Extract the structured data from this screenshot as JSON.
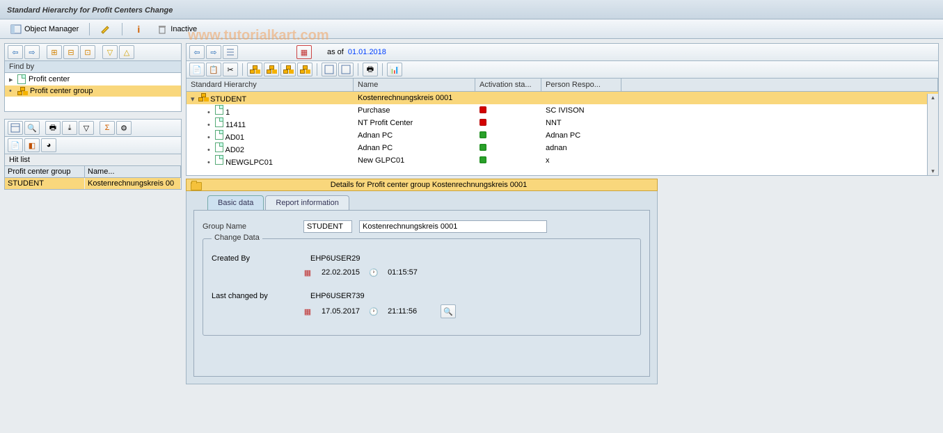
{
  "title": "Standard Hierarchy for Profit Centers Change",
  "app_toolbar": {
    "object_manager": "Object Manager",
    "inactive": "Inactive"
  },
  "watermark": "www.tutorialkart.com",
  "findby": {
    "header": "Find by",
    "items": [
      {
        "label": "Profit center",
        "selected": false
      },
      {
        "label": "Profit center group",
        "selected": true
      }
    ]
  },
  "hitlist": {
    "title": "Hit list",
    "columns": [
      "Profit center group",
      "Name..."
    ],
    "rows": [
      {
        "group": "STUDENT",
        "name": "Kostenrechnungskreis 00",
        "selected": true
      }
    ]
  },
  "asof": {
    "label": "as of",
    "date": "01.01.2018"
  },
  "grid": {
    "columns": [
      "Standard Hierarchy",
      "Name",
      "Activation sta...",
      "Person Respo..."
    ],
    "rows": [
      {
        "indent": 0,
        "type": "group",
        "code": "STUDENT",
        "name": "Kostenrechnungskreis 0001",
        "status": "",
        "person": ""
      },
      {
        "indent": 1,
        "type": "node",
        "code": "1",
        "name": "Purchase",
        "status": "red",
        "person": "SC IVISON"
      },
      {
        "indent": 1,
        "type": "node",
        "code": "11411",
        "name": "NT Profit Center",
        "status": "red",
        "person": "NNT"
      },
      {
        "indent": 1,
        "type": "node",
        "code": "AD01",
        "name": "Adnan PC",
        "status": "green",
        "person": "Adnan PC"
      },
      {
        "indent": 1,
        "type": "node",
        "code": "AD02",
        "name": "Adnan PC",
        "status": "green",
        "person": "adnan"
      },
      {
        "indent": 1,
        "type": "node",
        "code": "NEWGLPC01",
        "name": "New GLPC01",
        "status": "green",
        "person": "x"
      }
    ]
  },
  "details_bar": "Details for Profit center group Kostenrechnungskreis 0001",
  "tabs": {
    "basic": "Basic data",
    "report": "Report information"
  },
  "form": {
    "label_group_name": "Group Name",
    "group_code": "STUDENT",
    "group_name": "Kostenrechnungskreis 0001",
    "change_data_title": "Change Data",
    "created_by_label": "Created By",
    "created_by": "EHP6USER29",
    "created_date": "22.02.2015",
    "created_time": "01:15:57",
    "last_changed_label": "Last changed by",
    "last_changed_by": "EHP6USER739",
    "last_changed_date": "17.05.2017",
    "last_changed_time": "21:11:56"
  }
}
